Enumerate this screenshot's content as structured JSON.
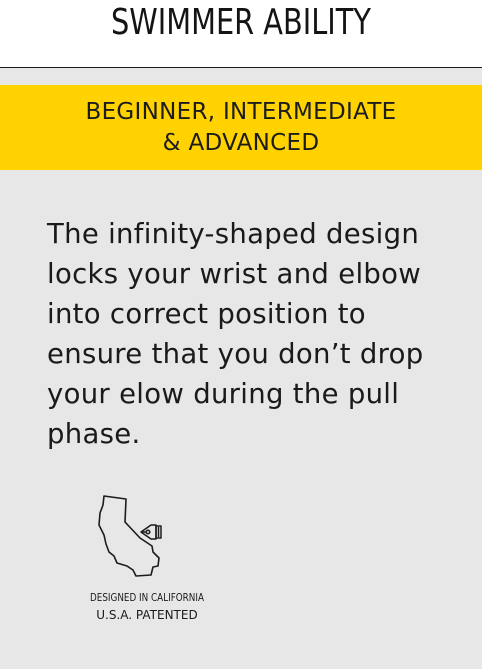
{
  "title": "SWIMMER ABILITY",
  "banner": {
    "line1": "BEGINNER, INTERMEDIATE",
    "line2": "& ADVANCED"
  },
  "description": "The infinity-shaped design locks your wrist and elbow into correct position to ensure that you don’t drop your elow during the pull phase.",
  "badge": {
    "icon": "california-pen-icon",
    "line1": "DESIGNED IN CALIFORNIA",
    "line2": "U.S.A. PATENTED"
  },
  "colors": {
    "banner": "#ffd200",
    "panel": "#e7e7e8",
    "text": "#1a1a1a"
  }
}
